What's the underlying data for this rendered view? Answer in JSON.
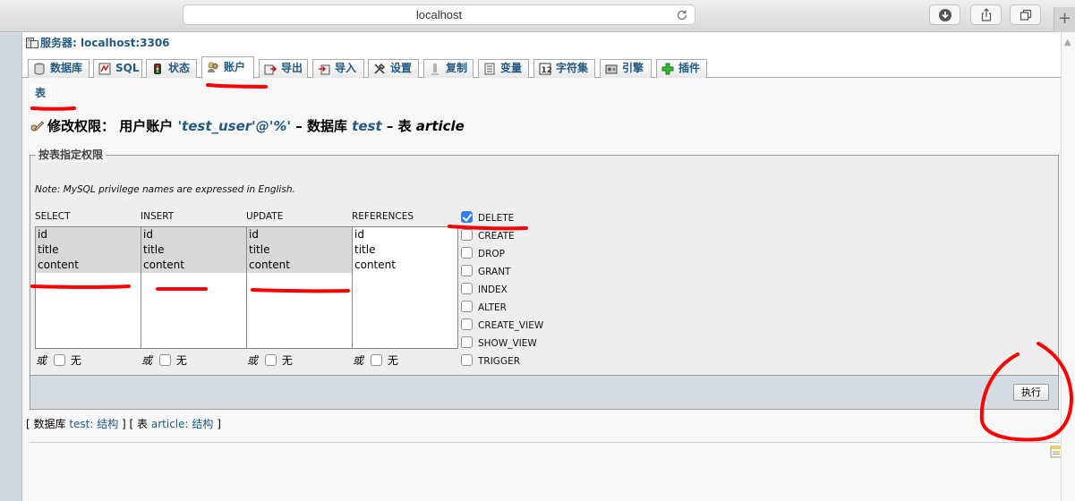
{
  "browser": {
    "url": "localhost"
  },
  "server": {
    "label": "服务器: localhost:3306"
  },
  "tabs": [
    {
      "label": "数据库",
      "icon": "database-icon"
    },
    {
      "label": "SQL",
      "icon": "sql-icon"
    },
    {
      "label": "状态",
      "icon": "status-icon"
    },
    {
      "label": "账户",
      "icon": "accounts-icon",
      "active": true
    },
    {
      "label": "导出",
      "icon": "export-icon"
    },
    {
      "label": "导入",
      "icon": "import-icon"
    },
    {
      "label": "设置",
      "icon": "settings-icon"
    },
    {
      "label": "复制",
      "icon": "replication-icon"
    },
    {
      "label": "变量",
      "icon": "variables-icon"
    },
    {
      "label": "字符集",
      "icon": "charset-icon"
    },
    {
      "label": "引擎",
      "icon": "engines-icon"
    },
    {
      "label": "插件",
      "icon": "plugins-icon"
    }
  ],
  "subtab": {
    "label": "表"
  },
  "heading": {
    "prefix": "修改权限：  用户账户",
    "user": "'test_user'@'%'",
    "db_sep": " – 数据库 ",
    "db": "test",
    "table_sep": " – 表 ",
    "table": "article"
  },
  "fieldset": {
    "legend": "按表指定权限",
    "note": "Note: MySQL privilege names are expressed in English.",
    "columns": [
      {
        "label": "SELECT",
        "options": [
          "id",
          "title",
          "content"
        ],
        "selected": true
      },
      {
        "label": "INSERT",
        "options": [
          "id",
          "title",
          "content"
        ],
        "selected": true
      },
      {
        "label": "UPDATE",
        "options": [
          "id",
          "title",
          "content"
        ],
        "selected": true
      },
      {
        "label": "REFERENCES",
        "options": [
          "id",
          "title",
          "content"
        ],
        "selected": false
      }
    ],
    "or_label": "或",
    "none_label": "无",
    "privileges": [
      {
        "label": "DELETE",
        "checked": true
      },
      {
        "label": "CREATE",
        "checked": false
      },
      {
        "label": "DROP",
        "checked": false
      },
      {
        "label": "GRANT",
        "checked": false
      },
      {
        "label": "INDEX",
        "checked": false
      },
      {
        "label": "ALTER",
        "checked": false
      },
      {
        "label": "CREATE_VIEW",
        "checked": false
      },
      {
        "label": "SHOW_VIEW",
        "checked": false
      },
      {
        "label": "TRIGGER",
        "checked": false
      }
    ]
  },
  "footer": {
    "go_label": "执行"
  },
  "breadcrumb": {
    "open": "[ ",
    "db_label": "数据库 ",
    "db_link": "test: 结构",
    "mid": " ] [ ",
    "table_label": "表 ",
    "table_link": "article: 结构",
    "close": " ]"
  },
  "colors": {
    "link": "#235a81",
    "annotation": "#ff0000",
    "checkbox_checked": "#2f7ff0"
  }
}
